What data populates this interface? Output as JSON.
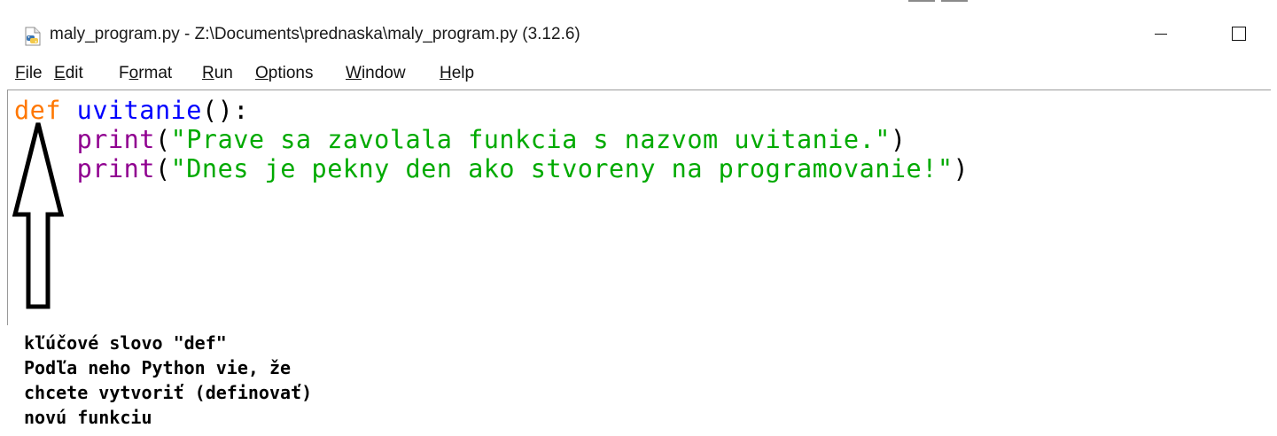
{
  "window": {
    "title": "maly_program.py - Z:\\Documents\\prednaska\\maly_program.py (3.12.6)",
    "app_icon": "python-file-icon",
    "minimize_icon": "minimize-icon",
    "maximize_icon": "maximize-icon"
  },
  "menu": [
    {
      "label": "File",
      "mnemonic": "F",
      "rest": "ile"
    },
    {
      "label": "Edit",
      "mnemonic": "E",
      "rest": "dit"
    },
    {
      "label": "Format",
      "pre": "F",
      "mnemonic": "o",
      "rest": "rmat"
    },
    {
      "label": "Run",
      "mnemonic": "R",
      "rest": "un"
    },
    {
      "label": "Options",
      "mnemonic": "O",
      "rest": "ptions"
    },
    {
      "label": "Window",
      "mnemonic": "W",
      "rest": "indow"
    },
    {
      "label": "Help",
      "mnemonic": "H",
      "rest": "elp"
    }
  ],
  "code": {
    "line1": {
      "keyword": "def",
      "name": "uvitanie",
      "tail": "():"
    },
    "line2": {
      "indent": "    ",
      "builtin": "print",
      "open": "(",
      "string": "\"Prave sa zavolala funkcia s nazvom uvitanie.\"",
      "close": ")"
    },
    "line3": {
      "indent": "    ",
      "builtin": "print",
      "open": "(",
      "string": "\"Dnes je pekny den ako stvoreny na programovanie!\"",
      "close": ")"
    }
  },
  "colors": {
    "keyword": "#ff7700",
    "definition": "#0000ff",
    "builtin": "#900090",
    "string": "#00aa00"
  },
  "annotation": {
    "arrow_icon": "up-arrow-icon",
    "lines": [
      "kľúčové slovo \"def\"",
      "Podľa neho Python vie, že",
      "chcete vytvoriť (definovať)",
      "novú funkciu"
    ]
  }
}
